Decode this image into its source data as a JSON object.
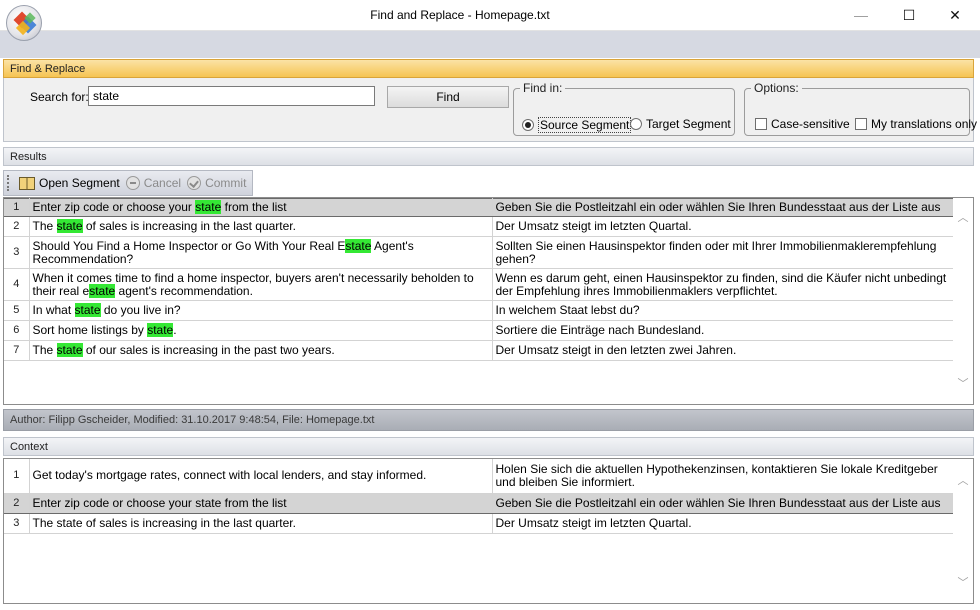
{
  "window": {
    "title": "Find and Replace - Homepage.txt",
    "minimize_glyph": "—",
    "maximize_glyph": "☐",
    "close_glyph": "✕"
  },
  "find_panel": {
    "header": "Find & Replace",
    "search_label": "Search for:",
    "search_value": "state",
    "find_button": "Find",
    "find_in": {
      "legend": "Find in:",
      "source_label": "Source Segment",
      "target_label": "Target Segment",
      "selected": "source"
    },
    "options": {
      "legend": "Options:",
      "case_sensitive_label": "Case-sensitive",
      "case_sensitive_checked": false,
      "my_translations_label": "My translations only",
      "my_translations_checked": false
    }
  },
  "results": {
    "header": "Results",
    "toolbar": {
      "open_segment": "Open Segment",
      "cancel": "Cancel",
      "commit": "Commit"
    },
    "rows": [
      {
        "num": "1",
        "source": [
          {
            "t": "Enter zip code or choose your "
          },
          {
            "t": "state",
            "hl": true
          },
          {
            "t": " from the list"
          }
        ],
        "target": "Geben Sie die Postleitzahl ein oder wählen Sie Ihren Bundesstaat aus der Liste aus",
        "selected": true
      },
      {
        "num": "2",
        "source": [
          {
            "t": "The "
          },
          {
            "t": "state",
            "hl": true
          },
          {
            "t": " of sales is increasing in the last quarter."
          }
        ],
        "target": "Der Umsatz steigt im letzten Quartal."
      },
      {
        "num": "3",
        "source": [
          {
            "t": "Should You Find a Home Inspector or Go With Your Real E"
          },
          {
            "t": "state",
            "hl": true
          },
          {
            "t": " Agent's Recommendation?"
          }
        ],
        "target": "Sollten Sie einen Hausinspektor finden oder mit Ihrer Immobilienmaklerempfehlung gehen?"
      },
      {
        "num": "4",
        "source": [
          {
            "t": "When it comes time to find a home inspector, buyers aren't necessarily beholden to their real e"
          },
          {
            "t": "state",
            "hl": true
          },
          {
            "t": " agent's recommendation."
          }
        ],
        "target": "Wenn es darum geht, einen Hausinspektor zu finden, sind die Käufer nicht unbedingt der Empfehlung ihres Immobilienmaklers verpflichtet."
      },
      {
        "num": "5",
        "source": [
          {
            "t": "In what "
          },
          {
            "t": "state",
            "hl": true
          },
          {
            "t": " do you live in?"
          }
        ],
        "target": "In welchem Staat lebst du?"
      },
      {
        "num": "6",
        "source": [
          {
            "t": "Sort home listings by "
          },
          {
            "t": "state",
            "hl": true
          },
          {
            "t": "."
          }
        ],
        "target": "Sortiere die Einträge nach Bundesland."
      },
      {
        "num": "7",
        "source": [
          {
            "t": "The "
          },
          {
            "t": "state",
            "hl": true
          },
          {
            "t": " of our sales is increasing in the past two years."
          }
        ],
        "target": "Der Umsatz steigt in den letzten zwei Jahren."
      }
    ]
  },
  "author_info": "Author: Filipp Gscheider, Modified: 31.10.2017 9:48:54, File: Homepage.txt",
  "context": {
    "header": "Context",
    "rows": [
      {
        "num": "1",
        "source": "Get today's mortgage rates, connect with local lenders, and stay informed.",
        "target": "Holen Sie sich die aktuellen Hypothekenzinsen, kontaktieren Sie lokale Kreditgeber und bleiben Sie informiert."
      },
      {
        "num": "2",
        "source": "Enter zip code or choose your state from the list",
        "target": "Geben Sie die Postleitzahl ein oder wählen Sie Ihren Bundesstaat aus der Liste aus",
        "selected": true
      },
      {
        "num": "3",
        "source": "The state of sales is increasing in the last quarter.",
        "target": "Der Umsatz steigt im letzten Quartal."
      }
    ]
  },
  "scroll_glyphs": {
    "up": "︿",
    "down": "﹀"
  }
}
